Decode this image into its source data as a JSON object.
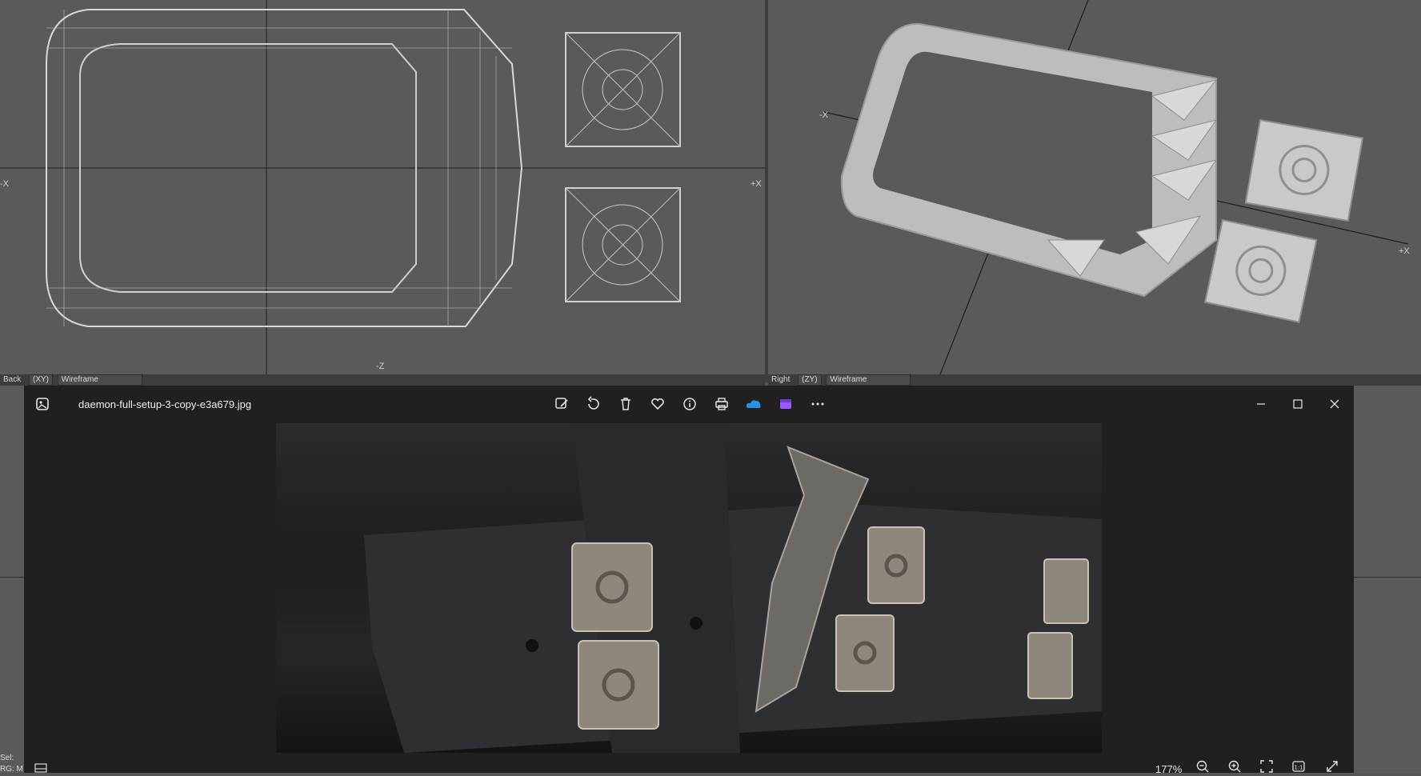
{
  "viewports": {
    "left": {
      "axes": {
        "minus_x": "-X",
        "plus_x": "+X",
        "minus_z": "-Z"
      },
      "bar": {
        "view": "Back",
        "plane": "(XY)",
        "shading": "Wireframe"
      }
    },
    "right": {
      "axes": {
        "minus_x": "-X",
        "plus_x": "+X"
      },
      "bar": {
        "view": "Right",
        "plane": "(ZY)",
        "shading": "Wireframe"
      }
    }
  },
  "lower": {
    "sel_label": "Sel:",
    "sel_value": "RG: M"
  },
  "viewer": {
    "filename": "daemon-full-setup-3-copy-e3a679.jpg",
    "toolbar": [
      "edit-icon",
      "rotate-icon",
      "delete-icon",
      "favorite-icon",
      "info-icon",
      "print-icon",
      "onedrive-icon",
      "clipchamp-icon",
      "more-icon"
    ],
    "zoom": "177%",
    "colors": {
      "onedrive": "#2b8fe6",
      "clipchamp": "#9b59ff",
      "background": "#202020"
    }
  }
}
